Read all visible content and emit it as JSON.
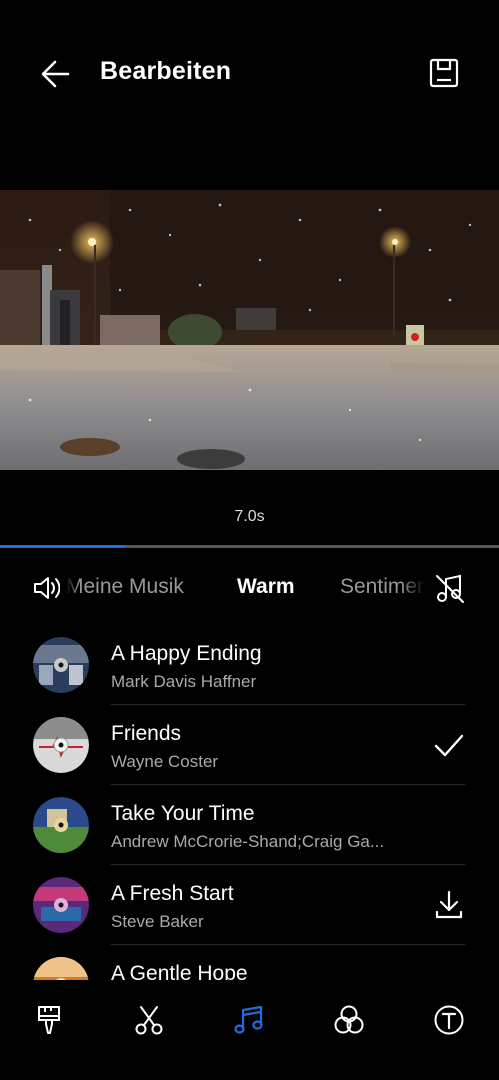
{
  "header": {
    "title": "Bearbeiten"
  },
  "video": {
    "duration": "7.0s",
    "progress_fraction": 0.25
  },
  "tabs": {
    "items": [
      {
        "label": "Meine Musik",
        "active": false
      },
      {
        "label": "Warm",
        "active": true
      },
      {
        "label": "Sentimen",
        "active": false
      }
    ]
  },
  "songs": [
    {
      "title": "A Happy Ending",
      "artist": "Mark Davis Haffner",
      "status": "none",
      "cover": "disc-blue"
    },
    {
      "title": "Friends",
      "artist": "Wayne Coster",
      "status": "selected",
      "cover": "disc-grey-red"
    },
    {
      "title": "Take Your Time",
      "artist": "Andrew McCrorie-Shand;Craig Ga...",
      "status": "none",
      "cover": "disc-green"
    },
    {
      "title": "A Fresh Start",
      "artist": "Steve  Baker",
      "status": "download",
      "cover": "disc-purple"
    },
    {
      "title": "A Gentle Hope",
      "artist": "",
      "status": "none",
      "cover": "disc-orange"
    }
  ],
  "toolbar": {
    "items": [
      {
        "name": "paint-brush-icon",
        "active": false
      },
      {
        "name": "scissors-icon",
        "active": false
      },
      {
        "name": "music-icon",
        "active": true
      },
      {
        "name": "filter-circles-icon",
        "active": false
      },
      {
        "name": "text-icon",
        "active": false
      }
    ]
  },
  "colors": {
    "accent": "#1e6fd9",
    "background": "#000000",
    "dim_text": "#999999"
  }
}
